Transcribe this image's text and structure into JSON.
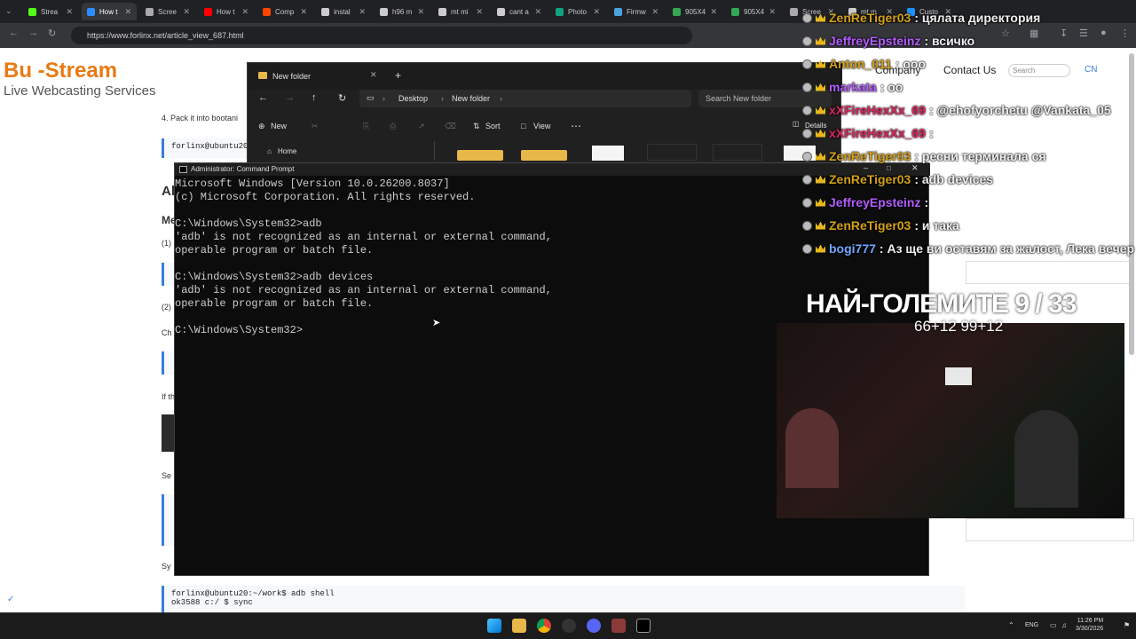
{
  "browser": {
    "tabs": [
      {
        "label": "Strea",
        "color": "#53fc18"
      },
      {
        "label": "How t",
        "color": "#2d8cff",
        "active": true
      },
      {
        "label": "Scree",
        "color": "#aaaaaa"
      },
      {
        "label": "How t",
        "color": "#ff0000"
      },
      {
        "label": "Comp",
        "color": "#ff4500"
      },
      {
        "label": "instal",
        "color": "#cccccc"
      },
      {
        "label": "h96 m",
        "color": "#cccccc"
      },
      {
        "label": "mt mi",
        "color": "#cccccc"
      },
      {
        "label": "cant a",
        "color": "#cccccc"
      },
      {
        "label": "Photo",
        "color": "#10a37f"
      },
      {
        "label": "Firmw",
        "color": "#4aa3df"
      },
      {
        "label": "905X4",
        "color": "#34a853"
      },
      {
        "label": "905X4",
        "color": "#34a853"
      },
      {
        "label": "Scree",
        "color": "#aaaaaa"
      },
      {
        "label": "mt m",
        "color": "#cccccc"
      },
      {
        "label": "Custo",
        "color": "#1e90ff"
      }
    ],
    "url": "https://www.forlinx.net/article_view_687.html"
  },
  "page": {
    "logo_line1": "Bu  -Stream",
    "logo_line2": "Live Webcasting Services",
    "nav_company": "Company",
    "nav_contact": "Contact Us",
    "search_placeholder": "Search",
    "lang": "CN",
    "step4": "4. Pack it into bootani",
    "code1": "forlinx@ubuntu20",
    "heading_a": "Al",
    "heading_me": "Me",
    "num1": "(1)",
    "num2": "(2)",
    "chk": "Ch",
    "ifthe": "If th",
    "ser": "Se",
    "syn": "Sy",
    "code_bottom1": "forlinx@ubuntu20:~/work$ adb shell",
    "code_bottom2": "ok3588 c:/ $ sync"
  },
  "explorer": {
    "tab_title": "New folder",
    "breadcrumb": [
      "Desktop",
      "New folder"
    ],
    "search_placeholder": "Search New folder",
    "new_label": "New",
    "sort_label": "Sort",
    "view_label": "View",
    "details_label": "Details",
    "home_label": "Home"
  },
  "cmd": {
    "title": "Administrator: Command Prompt",
    "lines": [
      "Microsoft Windows [Version 10.0.26200.8037]",
      "(c) Microsoft Corporation. All rights reserved.",
      "",
      "C:\\Windows\\System32>adb",
      "'adb' is not recognized as an internal or external command,",
      "operable program or batch file.",
      "",
      "C:\\Windows\\System32>adb devices",
      "'adb' is not recognized as an internal or external command,",
      "operable program or batch file.",
      "",
      "C:\\Windows\\System32>"
    ]
  },
  "chat": [
    {
      "user": "ZenReTiger03",
      "text": ": цялата директория",
      "color": "#d4a017"
    },
    {
      "user": "JeffreyEpsteinz",
      "text": ": всичко",
      "color": "#b45cff"
    },
    {
      "user": "Anton_011",
      "text": ": ооо",
      "color": "#d4a017"
    },
    {
      "user": "markata",
      "text": ": оо",
      "color": "#b45cff"
    },
    {
      "user": "xXFireHexXx_69",
      "text": ": @ehofyorchetu @Vankata_05",
      "color": "#e0245e"
    },
    {
      "user": "xXFireHexXx_69",
      "text": ":",
      "color": "#e0245e"
    },
    {
      "user": "ZenReTiger03",
      "text": ": ресни терминала ся",
      "color": "#d4a017"
    },
    {
      "user": "ZenReTiger03",
      "text": ": adb devices",
      "color": "#d4a017"
    },
    {
      "user": "JeffreyEpsteinz",
      "text": ":",
      "color": "#b45cff"
    },
    {
      "user": "ZenReTiger03",
      "text": ": и така",
      "color": "#d4a017"
    },
    {
      "user": "bogi777",
      "text": ": Аз ще ви оставям за жалост, Лека вечер",
      "color": "#6fa8ff"
    }
  ],
  "overlay": {
    "title": "НАЙ-ГОЛЕМИТЕ 9 / 33",
    "score": "66+12 99+12"
  },
  "taskbar": {
    "lang": "ENG",
    "time": "11:26 PM",
    "date": "3/30/2026"
  }
}
